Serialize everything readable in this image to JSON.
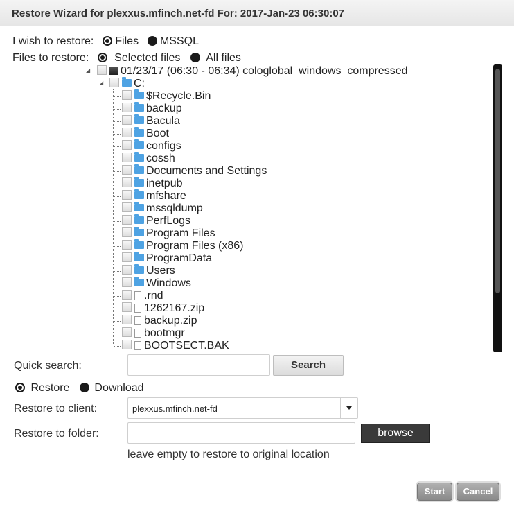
{
  "title": "Restore Wizard for plexxus.mfinch.net-fd For: 2017-Jan-23 06:30:07",
  "restore_type": {
    "label": "I wish to restore:",
    "options": [
      "Files",
      "MSSQL"
    ],
    "selected": "Files"
  },
  "files_to_restore": {
    "label": "Files to restore:",
    "options": [
      "Selected files",
      "All files"
    ],
    "selected": "Selected files"
  },
  "tree": {
    "root": "01/23/17 (06:30 - 06:34) cologlobal_windows_compressed",
    "drive": "C:",
    "items": [
      {
        "name": "$Recycle.Bin",
        "type": "folder"
      },
      {
        "name": "backup",
        "type": "folder"
      },
      {
        "name": "Bacula",
        "type": "folder"
      },
      {
        "name": "Boot",
        "type": "folder"
      },
      {
        "name": "configs",
        "type": "folder"
      },
      {
        "name": "cossh",
        "type": "folder"
      },
      {
        "name": "Documents and Settings",
        "type": "folder"
      },
      {
        "name": "inetpub",
        "type": "folder"
      },
      {
        "name": "mfshare",
        "type": "folder"
      },
      {
        "name": "mssqldump",
        "type": "folder"
      },
      {
        "name": "PerfLogs",
        "type": "folder"
      },
      {
        "name": "Program Files",
        "type": "folder"
      },
      {
        "name": "Program Files (x86)",
        "type": "folder"
      },
      {
        "name": "ProgramData",
        "type": "folder"
      },
      {
        "name": "Users",
        "type": "folder"
      },
      {
        "name": "Windows",
        "type": "folder"
      },
      {
        "name": ".rnd",
        "type": "file"
      },
      {
        "name": "1262167.zip",
        "type": "file"
      },
      {
        "name": "backup.zip",
        "type": "file"
      },
      {
        "name": "bootmgr",
        "type": "file"
      },
      {
        "name": "BOOTSECT.BAK",
        "type": "file"
      }
    ]
  },
  "quick_search": {
    "label": "Quick search:",
    "value": "",
    "button": "Search"
  },
  "action": {
    "options": [
      "Restore",
      "Download"
    ],
    "selected": "Restore"
  },
  "restore_to_client": {
    "label": "Restore to client:",
    "value": "plexxus.mfinch.net-fd"
  },
  "restore_to_folder": {
    "label": "Restore to folder:",
    "value": "",
    "browse": "browse",
    "hint": "leave empty to restore to original location"
  },
  "footer": {
    "start": "Start",
    "cancel": "Cancel"
  }
}
